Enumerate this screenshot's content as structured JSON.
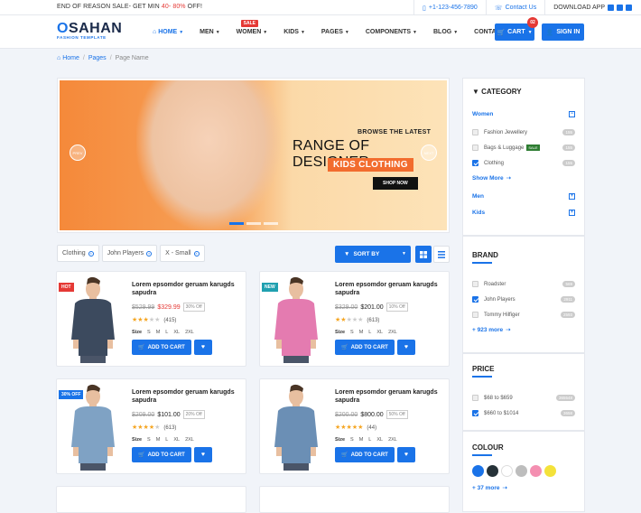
{
  "topbar": {
    "sale_prefix": "END OF REASON SALE- GET MIN ",
    "sale_range": "40- 80%",
    "sale_suffix": " OFF!",
    "phone": "+1-123-456-7890",
    "contact": "Contact Us",
    "download": "DOWNLOAD APP"
  },
  "logo": {
    "name_accent": "O",
    "name_rest": "SAHAN",
    "tagline": "FASHION TEMPLATE"
  },
  "menu": [
    {
      "label": "HOME",
      "active": true
    },
    {
      "label": "MEN"
    },
    {
      "label": "WOMEN",
      "badge": "SALE"
    },
    {
      "label": "KIDS"
    },
    {
      "label": "PAGES"
    },
    {
      "label": "COMPONENTS"
    },
    {
      "label": "BLOG"
    },
    {
      "label": "CONTACT"
    }
  ],
  "cart": {
    "label": "CART",
    "count": "02"
  },
  "signin": "SIGN IN",
  "breadcrumb": {
    "home": "Home",
    "pages": "Pages",
    "current": "Page Name"
  },
  "banner": {
    "line1": "BROWSE THE LATEST",
    "line2": "RANGE OF DESIGNER",
    "line3": "KIDS CLOTHING",
    "cta": "SHOP NOW",
    "prev": "PREV",
    "next": "NEXT"
  },
  "filters": [
    "Clothing",
    "John Players",
    "X - Small"
  ],
  "sort_label": "SORT BY",
  "products": [
    {
      "tag": "HOT",
      "tag_color": "#e53935",
      "title": "Lorem epsomdor geruam karugds sapudra",
      "old_price": "$529.99",
      "price": "$329.99",
      "price_red": true,
      "off": "30% Off",
      "stars": "★★★",
      "empty": "★★",
      "reviews": "(415)",
      "shirt": "#3c4a5e"
    },
    {
      "tag": "NEW",
      "tag_color": "#20a0b0",
      "title": "Lorem epsomdor geruam karugds sapudra",
      "old_price": "$329.00",
      "price": "$201.00",
      "price_red": false,
      "off": "10% Off",
      "stars": "★★",
      "empty": "★★★",
      "reviews": "(613)",
      "shirt": "#e47bb0"
    },
    {
      "tag": "30% OFF",
      "tag_color": "#1a73e8",
      "title": "Lorem epsomdor geruam karugds sapudra",
      "old_price": "$209.00",
      "price": "$101.00",
      "price_red": false,
      "off": "20% Off",
      "stars": "★★★★",
      "empty": "★",
      "reviews": "(613)",
      "shirt": "#7fa2c4"
    },
    {
      "tag": "",
      "tag_color": "",
      "title": "Lorem epsomdor geruam karugds sapudra",
      "old_price": "$200.00",
      "price": "$800.00",
      "price_red": false,
      "off": "50% Off",
      "stars": "★★★★★",
      "empty": "",
      "reviews": "(44)",
      "shirt": "#6b8fb5"
    }
  ],
  "size_label": "Size",
  "sizes": [
    "S",
    "M",
    "L",
    "XL",
    "2XL"
  ],
  "add_to_cart": "ADD TO CART",
  "sidebar": {
    "category": {
      "title": "CATEGORY",
      "women": "Women",
      "items": [
        {
          "label": "Fashion Jewellery",
          "count": "155",
          "checked": false
        },
        {
          "label": "Bags & Luggage",
          "count": "155",
          "checked": false,
          "sale": "SALE"
        },
        {
          "label": "Clothing",
          "count": "155",
          "checked": true
        }
      ],
      "show_more": "Show More",
      "men": "Men",
      "kids": "Kids"
    },
    "brand": {
      "title": "BRAND",
      "items": [
        {
          "label": "Roadster",
          "count": "569",
          "checked": false
        },
        {
          "label": "John Players",
          "count": "2911",
          "checked": true
        },
        {
          "label": "Tommy Hilfiger",
          "count": "2593",
          "checked": false
        }
      ],
      "more": "+ 923 more"
    },
    "price": {
      "title": "PRICE",
      "items": [
        {
          "label": "$68 to $659",
          "count": "365548",
          "checked": false
        },
        {
          "label": "$660 to $1014",
          "count": "3658",
          "checked": true
        }
      ]
    },
    "colour": {
      "title": "COLOUR",
      "swatches": [
        "#1a73e8",
        "#263238",
        "#ffffff",
        "#bdbdbd",
        "#f48fb1",
        "#f4e23a"
      ],
      "more": "+ 37 more"
    }
  }
}
